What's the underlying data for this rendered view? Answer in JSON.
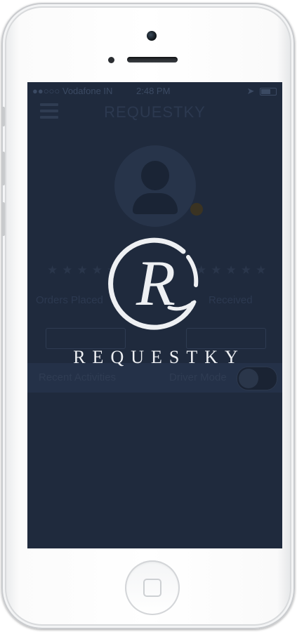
{
  "status_bar": {
    "carrier": "●●○○○ Vodafone IN",
    "time": "2:48 PM"
  },
  "app": {
    "title": "REQUESTKY"
  },
  "profile": {
    "rating_left": "★★★★★",
    "rating_right": "★★★★★",
    "orders_placed_label": "Orders Placed",
    "orders_received_label": "Received"
  },
  "bottom_band": {
    "recent_activities": "Recent Activities",
    "driver_mode": "Driver Mode"
  },
  "splash": {
    "brand_name": "REQUESTKY",
    "logo_letter": "R",
    "colors": {
      "background": "#1f2a3d",
      "logo": "#eef0f3"
    }
  }
}
